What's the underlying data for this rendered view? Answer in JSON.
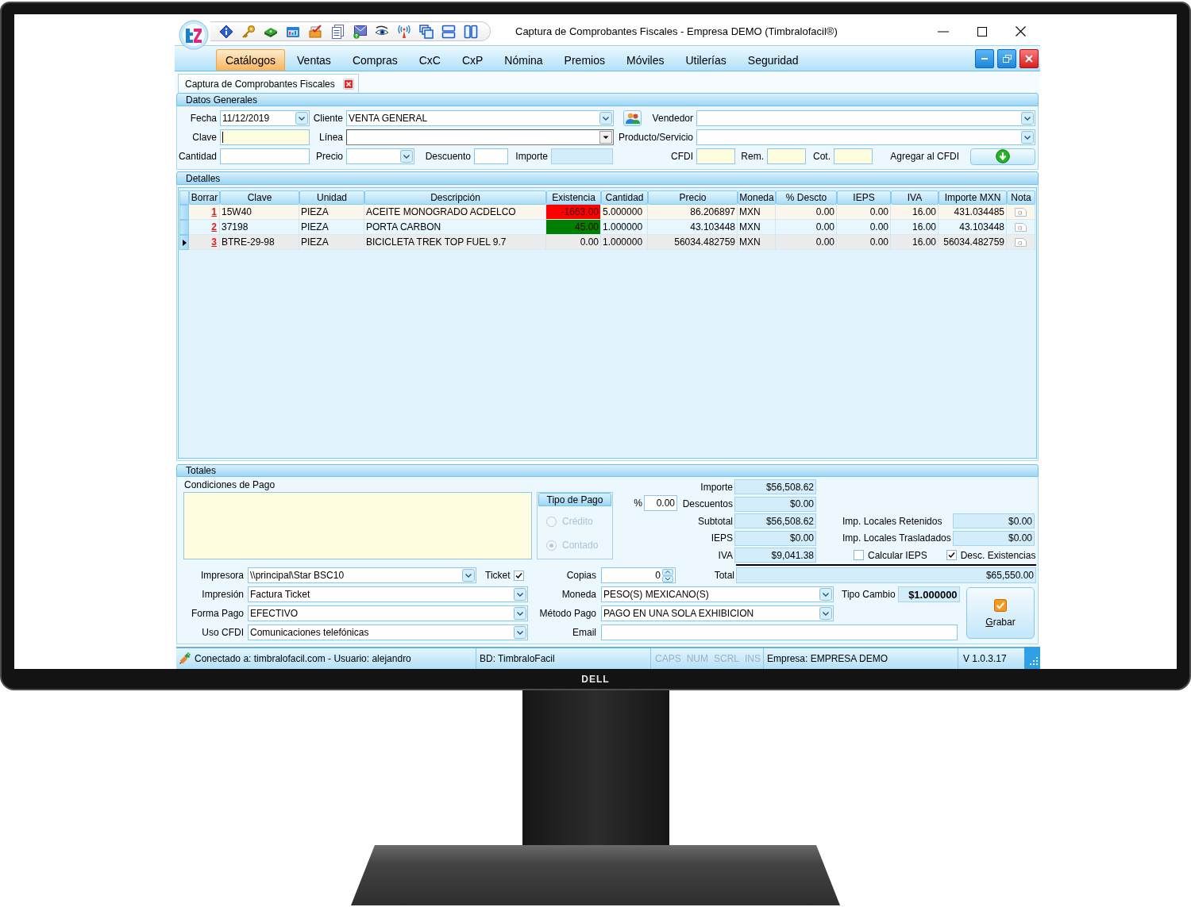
{
  "monitor": {
    "brand": "DELL"
  },
  "window": {
    "title": "Captura de Comprobantes Fiscales - Empresa DEMO (Timbralofacil®)"
  },
  "menu": [
    {
      "label": "Catálogos",
      "selected": true
    },
    {
      "label": "Ventas",
      "selected": false
    },
    {
      "label": "Compras",
      "selected": false
    },
    {
      "label": "CxC",
      "selected": false
    },
    {
      "label": "CxP",
      "selected": false
    },
    {
      "label": "Nómina",
      "selected": false
    },
    {
      "label": "Premios",
      "selected": false
    },
    {
      "label": "Móviles",
      "selected": false
    },
    {
      "label": "Utilerías",
      "selected": false
    },
    {
      "label": "Seguridad",
      "selected": false
    }
  ],
  "document_tabs": [
    {
      "label": "Captura de Comprobantes Fiscales",
      "selected": true
    }
  ],
  "datos_generales": {
    "title": "Datos Generales",
    "fecha": {
      "label": "Fecha",
      "value": "11/12/2019"
    },
    "cliente": {
      "label": "Cliente",
      "value": "VENTA GENERAL"
    },
    "vendedor": {
      "label": "Vendedor"
    },
    "clave": {
      "label": "Clave",
      "focused": true
    },
    "linea": {
      "label": "Línea"
    },
    "producto_servicio": {
      "label": "Producto/Servicio"
    },
    "cantidad": {
      "label": "Cantidad"
    },
    "precio": {
      "label": "Precio"
    },
    "descuento": {
      "label": "Descuento"
    },
    "importe": {
      "label": "Importe"
    },
    "cfdi": {
      "label": "CFDI"
    },
    "rem": {
      "label": "Rem."
    },
    "cot": {
      "label": "Cot."
    },
    "agregar": {
      "label": "Agregar al CFDI"
    }
  },
  "detalles": {
    "title": "Detalles",
    "columns": [
      "Borrar",
      "Clave",
      "Unidad",
      "Descripción",
      "Existencia",
      "Cantidad",
      "Precio",
      "Moneda",
      "% Descto",
      "IEPS",
      "IVA",
      "Importe MXN",
      "Nota"
    ],
    "rows": [
      {
        "selected": false,
        "number": "1",
        "clave": "15W40",
        "unidad": "PIEZA",
        "descripcion": "ACEITE MONOGRADO ACDELCO",
        "existencia": "-1663.00",
        "color": "#ff0000",
        "cantidad": "5.000000",
        "precio": "86.206897",
        "moneda": "MXN",
        "descuento": "0.00",
        "ieps": "0.00",
        "iva": "16.00",
        "importe": "431.034485"
      },
      {
        "selected": false,
        "number": "2",
        "clave": "37198",
        "unidad": "PIEZA",
        "descripcion": "PORTA CARBON",
        "existencia": "45.00",
        "color": "#008000",
        "cantidad": "1.000000",
        "precio": "43.103448",
        "moneda": "MXN",
        "descuento": "0.00",
        "ieps": "0.00",
        "iva": "16.00",
        "importe": "43.103448"
      },
      {
        "selected": true,
        "number": "3",
        "clave": "BTRE-29-98",
        "unidad": "PIEZA",
        "descripcion": "BICICLETA TREK TOP FUEL 9.7",
        "existencia": "0.00",
        "cantidad": "1.000000",
        "precio": "56034.482759",
        "moneda": "MXN",
        "descuento": "0.00",
        "ieps": "0.00",
        "iva": "16.00",
        "importe": "56034.482759"
      }
    ]
  },
  "totales": {
    "title": "Totales",
    "condiciones_pago": {
      "label": "Condiciones de Pago"
    },
    "tipo_pago": {
      "title": "Tipo de Pago",
      "disabled": true,
      "options": [
        {
          "label": "Crédito",
          "selected": false
        },
        {
          "label": "Contado",
          "selected": true
        }
      ]
    },
    "descuento_pct": {
      "label": "%",
      "value": "0.00"
    },
    "amounts": [
      {
        "label": "Importe",
        "value": "$56,508.62"
      },
      {
        "label": "Descuentos",
        "value": "$0.00"
      },
      {
        "label": "Subtotal",
        "value": "$56,508.62"
      },
      {
        "label": "IEPS",
        "value": "$0.00"
      },
      {
        "label": "IVA",
        "value": "$9,041.38"
      }
    ],
    "impuestos_locales": [
      {
        "label": "Imp. Locales Retenidos",
        "value": "$0.00"
      },
      {
        "label": "Imp. Locales Trasladados",
        "value": "$0.00"
      }
    ],
    "options": [
      {
        "label": "Calcular IEPS",
        "checked": false
      },
      {
        "label": "Desc. Existencias",
        "checked": true
      }
    ],
    "total": {
      "label": "Total",
      "value": "$65,550.00"
    },
    "impresora": {
      "label": "Impresora",
      "value": "\\\\principal\\Star BSC10"
    },
    "ticket": {
      "label": "Ticket",
      "checked": true
    },
    "copias": {
      "label": "Copias",
      "value": "0"
    },
    "impresion": {
      "label": "Impresión",
      "value": "Factura Ticket"
    },
    "moneda": {
      "label": "Moneda",
      "value": "PESO(S) MEXICANO(S)"
    },
    "tipo_cambio": {
      "label": "Tipo Cambio",
      "value": "$1.000000"
    },
    "forma_pago": {
      "label": "Forma Pago",
      "value": "EFECTIVO"
    },
    "metodo_pago": {
      "label": "Método Pago",
      "value": "PAGO EN UNA SOLA EXHIBICION"
    },
    "uso_cfdi": {
      "label": "Uso CFDI",
      "value": "Comunicaciones telefónicas"
    },
    "email": {
      "label": "Email"
    },
    "grabar": {
      "label": "Grabar"
    }
  },
  "status_bar": {
    "connection": "Conectado a: timbralofacil.com - Usuario: alejandro",
    "database": "BD: TimbraloFacil",
    "keys": [
      {
        "label": "CAPS",
        "on": false
      },
      {
        "label": "NUM",
        "on": false
      },
      {
        "label": "SCRL",
        "on": false
      },
      {
        "label": "INS",
        "on": false
      }
    ],
    "company": "Empresa: EMPRESA DEMO",
    "version": "V 1.0.3.17"
  }
}
